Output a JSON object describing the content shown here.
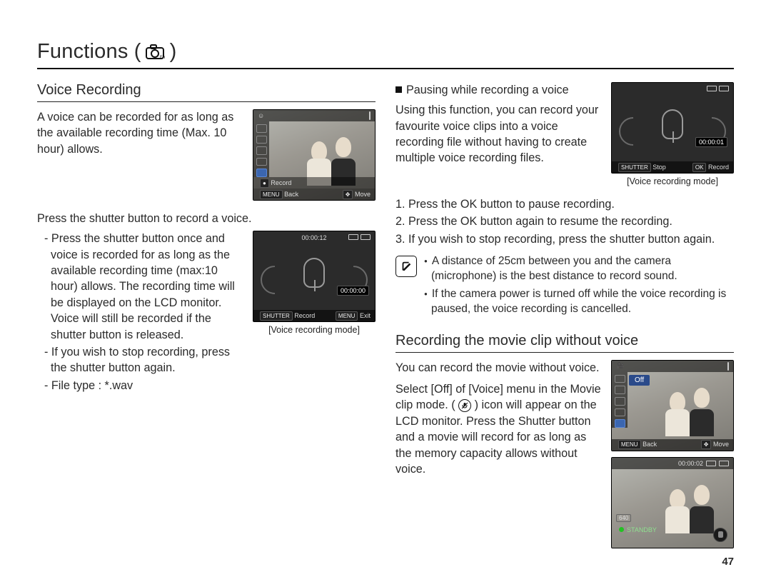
{
  "page_number": "47",
  "title_prefix": "Functions (",
  "title_suffix": " )",
  "left": {
    "section_title": "Voice Recording",
    "intro": "A voice can be recorded for as long as the available recording time (Max. 10 hour) allows.",
    "press_shutter": "Press the shutter button to record a voice.",
    "bullets": [
      "Press the shutter button once and voice is recorded for as long as the available recording time (max:10 hour) allows. The recording time will be displayed on the LCD monitor. Voice will still be recorded if the shutter button is released.",
      "If you wish to stop recording, press the shutter button again.",
      "File type : *.wav"
    ],
    "caption1": "[Voice recording mode]",
    "thumb1": {
      "bot_left": "Back",
      "bot_right": "Move",
      "row2_left": "Record",
      "top_face": " "
    },
    "thumb2": {
      "top_timer": "00:00:12",
      "chip": "00:00:00",
      "bot_left_btn": "SHUTTER",
      "bot_left": "Record",
      "bot_right_btn": "MENU",
      "bot_right": "Exit"
    }
  },
  "right": {
    "pause_heading": "Pausing while recording a voice",
    "pause_body": "Using this function, you can record your favourite voice clips into a voice recording file without having to create multiple voice recording files.",
    "steps": [
      "1. Press the OK button to pause recording.",
      "2. Press the OK button again to resume the recording.",
      "3. If you wish to stop recording, press the shutter button again."
    ],
    "notes": [
      "A distance of 25cm between you and the camera (microphone) is the best distance to record sound.",
      "If the camera power is turned off while the voice recording is paused, the voice recording is cancelled."
    ],
    "caption1": "[Voice recording mode]",
    "thumb_pause": {
      "chip": "00:00:01",
      "bot_left_btn": "SHUTTER",
      "bot_left": "Stop",
      "bot_right_btn": "OK",
      "bot_right": "Record"
    },
    "section2_title": "Recording the movie clip without voice",
    "section2_intro": "You can record the movie without voice.",
    "section2_body_a": "Select [Off] of [Voice] menu in the Movie clip mode. (",
    "section2_body_b": ") icon will appear on the LCD monitor. Press the Shutter button and a movie will record for as long as the memory capacity allows without voice.",
    "thumb_menu": {
      "off_label": "Off",
      "bot_left": "Back",
      "bot_right": "Move"
    },
    "thumb_standby": {
      "top_timer": "00:00:02",
      "res": "640",
      "standby": "STANDBY"
    }
  }
}
